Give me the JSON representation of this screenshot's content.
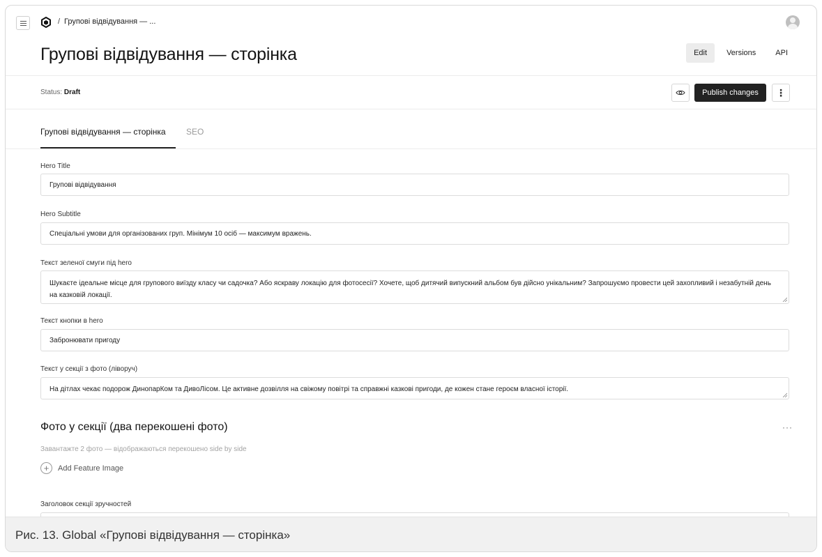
{
  "breadcrumb": {
    "separator": "/",
    "current": "Групові відвідування — ..."
  },
  "page": {
    "title": "Групові відвідування — сторінка"
  },
  "view_tabs": [
    {
      "label": "Edit",
      "active": true
    },
    {
      "label": "Versions",
      "active": false
    },
    {
      "label": "API",
      "active": false
    }
  ],
  "status": {
    "prefix": "Status:",
    "value": "Draft"
  },
  "actions": {
    "publish_label": "Publish changes",
    "more_label": "⋮"
  },
  "content_tabs": [
    {
      "label": "Групові відвідування — сторінка",
      "active": true
    },
    {
      "label": "SEO",
      "active": false
    }
  ],
  "fields": [
    {
      "label": "Hero Title",
      "value": "Групові відвідування"
    },
    {
      "label": "Hero Subtitle",
      "value": "Спеціальні умови для організованих груп. Мінімум 10 осіб — максимум вражень."
    },
    {
      "label": "Текст зеленої смуги під hero",
      "value": "Шукаєте ідеальне місце для групового виїзду класу чи садочка? Або яскраву локацію для фотосесії? Хочете, щоб дитячий випускний альбом був дійсно унікальним? Запрошуємо провести цей захопливий і незабутній день на казковій локації."
    },
    {
      "label": "Текст кнопки в hero",
      "value": "Забронювати пригоду"
    },
    {
      "label": "Текст у секції з фото (ліворуч)",
      "value": "На дітлах чекає подорож ДинопарКом та ДивоЛісом. Це активне дозвілля на свіжому повітрі та справжні казкові пригоди, де кожен стане героєм власної історії."
    },
    {
      "label": "Заголовок секції зручностей",
      "value": ""
    }
  ],
  "photo_section": {
    "title": "Фото у секції (два перекошені фото)",
    "description": "Завантажте 2 фото — відображаються перекошено side by side",
    "add_label": "Add Feature Image",
    "more_label": "···"
  },
  "caption": "Рис. 13. Global «Групові відвідування — сторінка»",
  "colors": {
    "primary_button": "#222222",
    "border": "#dcdcdc",
    "muted_text": "#9a9a9a"
  }
}
